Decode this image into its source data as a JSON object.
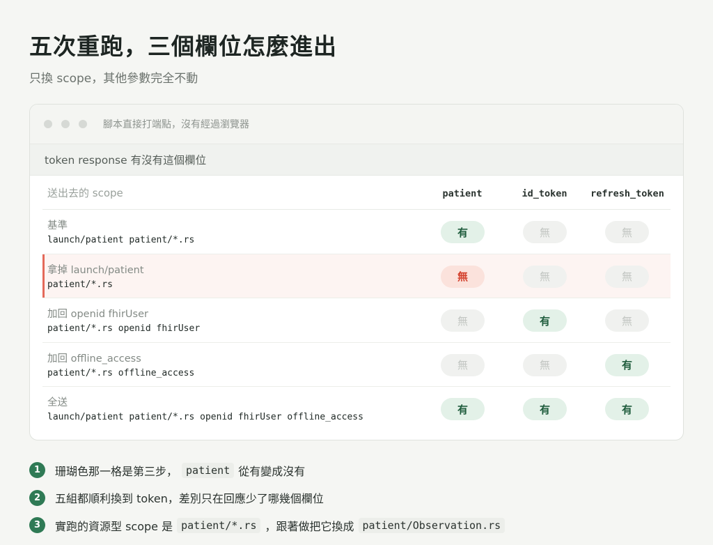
{
  "header": {
    "title": "五次重跑，三個欄位怎麼進出",
    "subtitle": "只換 scope，其他參數完全不動"
  },
  "window": {
    "title": "腳本直接打端點，沒有經過瀏覽器",
    "section_title": "token response 有沒有這個欄位"
  },
  "table": {
    "columns": {
      "scope": "送出去的 scope",
      "a": "patient",
      "b": "id_token",
      "c": "refresh_token"
    },
    "rows": [
      {
        "label": "基準",
        "scope": "launch/patient patient/*.rs",
        "a": "有",
        "b": "無",
        "c": "無",
        "a_state": "yes",
        "b_state": "no",
        "c_state": "no",
        "highlight": false
      },
      {
        "label": "拿掉 launch/patient",
        "scope": "patient/*.rs",
        "a": "無",
        "b": "無",
        "c": "無",
        "a_state": "alert",
        "b_state": "no",
        "c_state": "no",
        "highlight": true
      },
      {
        "label": "加回 openid fhirUser",
        "scope": "patient/*.rs openid fhirUser",
        "a": "無",
        "b": "有",
        "c": "無",
        "a_state": "no",
        "b_state": "yes",
        "c_state": "no",
        "highlight": false
      },
      {
        "label": "加回 offline_access",
        "scope": "patient/*.rs offline_access",
        "a": "無",
        "b": "無",
        "c": "有",
        "a_state": "no",
        "b_state": "no",
        "c_state": "yes",
        "highlight": false
      },
      {
        "label": "全送",
        "scope": "launch/patient patient/*.rs openid fhirUser offline_access",
        "a": "有",
        "b": "有",
        "c": "有",
        "a_state": "yes",
        "b_state": "yes",
        "c_state": "yes",
        "highlight": false
      }
    ]
  },
  "notes": [
    {
      "num": "1",
      "pre": "珊瑚色那一格是第三步，",
      "code1": "patient",
      "mid": "從有變成沒有",
      "code2": "",
      "post": ""
    },
    {
      "num": "2",
      "pre": "五組都順利換到 token，差別只在回應少了哪幾個欄位",
      "code1": "",
      "mid": "",
      "code2": "",
      "post": ""
    },
    {
      "num": "3",
      "pre": "實跑的資源型 scope 是",
      "code1": "patient/*.rs",
      "mid": "，跟著做把它換成",
      "code2": "patient/Observation.rs",
      "post": ""
    }
  ],
  "colors": {
    "accent": "#2f7a55",
    "alert": "#e4695a",
    "yes_bg": "#e3f1e8",
    "no_bg": "#f0f1ef"
  }
}
